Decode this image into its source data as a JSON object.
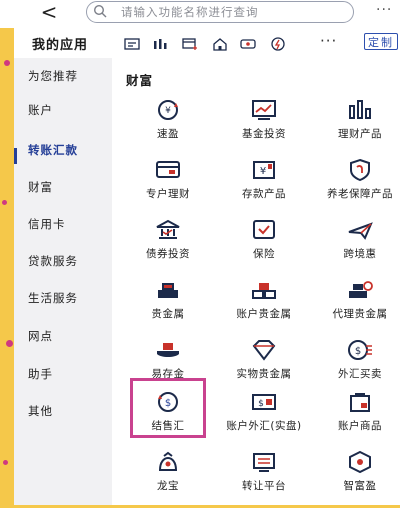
{
  "topbar": {
    "back_glyph": "<",
    "search_placeholder": "请输入功能名称进行查询",
    "more": "···"
  },
  "appsbar": {
    "title": "我的应用",
    "more": "···",
    "edit": "定制"
  },
  "sidebar": {
    "items": [
      {
        "label": "为您推荐"
      },
      {
        "label": "账户"
      },
      {
        "label": "转账汇款"
      },
      {
        "label": "财富"
      },
      {
        "label": "信用卡"
      },
      {
        "label": "贷款服务"
      },
      {
        "label": "生活服务"
      },
      {
        "label": "网点"
      },
      {
        "label": "助手"
      },
      {
        "label": "其他"
      }
    ],
    "active_index": 2
  },
  "content": {
    "section_title": "财富",
    "grid": [
      {
        "label": "速盈",
        "icon": "yen-refresh-icon"
      },
      {
        "label": "基金投资",
        "icon": "trend-chart-icon"
      },
      {
        "label": "理财产品",
        "icon": "bar-chart-icon"
      },
      {
        "label": "专户理财",
        "icon": "card-icon"
      },
      {
        "label": "存款产品",
        "icon": "yen-box-icon"
      },
      {
        "label": "养老保障产品",
        "icon": "shield-hook-icon"
      },
      {
        "label": "债券投资",
        "icon": "bond-house-icon"
      },
      {
        "label": "保险",
        "icon": "check-box-icon"
      },
      {
        "label": "跨境惠",
        "icon": "plane-icon"
      },
      {
        "label": "贵金属",
        "icon": "gold-bars-icon"
      },
      {
        "label": "账户贵金属",
        "icon": "gold-stack-icon"
      },
      {
        "label": "代理贵金属",
        "icon": "gold-agent-icon"
      },
      {
        "label": "易存金",
        "icon": "gold-save-icon"
      },
      {
        "label": "实物贵金属",
        "icon": "diamond-icon"
      },
      {
        "label": "外汇买卖",
        "icon": "exchange-icon"
      },
      {
        "label": "结售汇",
        "icon": "dollar-cycle-icon"
      },
      {
        "label": "账户外汇(实盘)",
        "icon": "dollar-card-icon"
      },
      {
        "label": "账户商品",
        "icon": "bag-icon"
      },
      {
        "label": "龙宝",
        "icon": "dragon-icon"
      },
      {
        "label": "转让平台",
        "icon": "transfer-icon"
      },
      {
        "label": "智富盈",
        "icon": "smart-badge-icon"
      }
    ]
  },
  "colors": {
    "accent": "#253f97",
    "highlight": "#c9428f",
    "icon_dark": "#1c2a4a",
    "icon_red": "#c8322a"
  }
}
